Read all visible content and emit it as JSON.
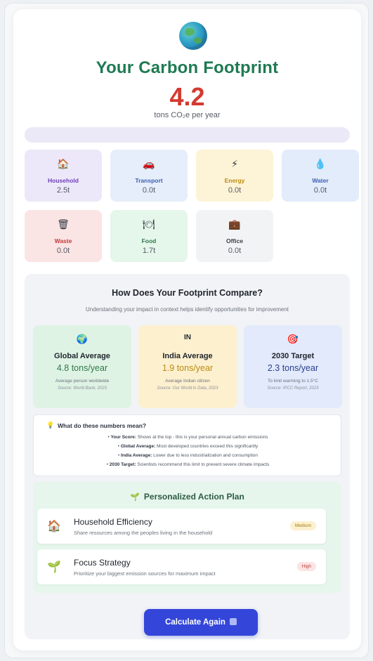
{
  "header": {
    "icon": "globe-icon",
    "title": "Your Carbon Footprint",
    "score": "4.2",
    "unit": "tons CO₂e per year"
  },
  "categories": [
    {
      "name": "Household",
      "value": "2.5t",
      "icon": "house-icon",
      "glyph": "🏠",
      "bg": "#ece8f9",
      "color": "#6d3fb8"
    },
    {
      "name": "Transport",
      "value": "0.0t",
      "icon": "car-icon",
      "glyph": "🚗",
      "bg": "#e6eefb",
      "color": "#3b5fb0"
    },
    {
      "name": "Energy",
      "value": "0.0t",
      "icon": "lightning-icon",
      "glyph": "⚡",
      "bg": "#fdf3d6",
      "color": "#b98b12"
    },
    {
      "name": "Water",
      "value": "0.0t",
      "icon": "droplet-icon",
      "glyph": "💧",
      "bg": "#e3ecfa",
      "color": "#3b5fb0"
    },
    {
      "name": "Waste",
      "value": "0.0t",
      "icon": "trash-icon",
      "glyph": "🗑",
      "bg": "#fbe4e4",
      "color": "#c23a3a"
    },
    {
      "name": "Food",
      "value": "1.7t",
      "icon": "plate-icon",
      "glyph": "🍽",
      "bg": "#e5f6ea",
      "color": "#2f7a4a"
    },
    {
      "name": "Office",
      "value": "0.0t",
      "icon": "briefcase-icon",
      "glyph": "💼",
      "bg": "#f2f3f5",
      "color": "#3a3f47"
    }
  ],
  "compare": {
    "title": "How Does Your Footprint Compare?",
    "subtitle": "Understanding your impact in context helps identify opportunities for improvement",
    "benchmarks": [
      {
        "icon_label": "🌍",
        "icon": "globe-icon",
        "name": "Global Average",
        "value": "4.8 tons/year",
        "desc": "Average person worldwide",
        "source": "Source: World Bank, 2023",
        "bg": "#dff3e5",
        "color": "#2f7a4a"
      },
      {
        "icon_label": "IN",
        "icon": "india-flag-icon",
        "name": "India Average",
        "value": "1.9 tons/year",
        "desc": "Average Indian citizen",
        "source": "Source: Our World in Data, 2023",
        "bg": "#fdf0cf",
        "color": "#b98b12"
      },
      {
        "icon_label": "🎯",
        "icon": "target-icon",
        "name": "2030 Target",
        "value": "2.3 tons/year",
        "desc": "To limit warming to 1.5°C",
        "source": "Source: IPCC Report, 2023",
        "bg": "#e2eafb",
        "color": "#2a3f8f"
      }
    ],
    "info": {
      "title": "What do these numbers mean?",
      "rows": [
        {
          "label": "Your Score:",
          "text": "Shows at the top - this is your personal annual carbon emissions"
        },
        {
          "label": "Global Average:",
          "text": "Most developed countries exceed this significantly"
        },
        {
          "label": "India Average:",
          "text": "Lower due to less industrialization and consumption"
        },
        {
          "label": "2030 Target:",
          "text": "Scientists recommend this limit to prevent severe climate impacts"
        }
      ]
    }
  },
  "plan": {
    "title": "Personalized Action Plan",
    "actions": [
      {
        "icon": "house-icon",
        "glyph": "🏠",
        "title": "Household Efficiency",
        "desc": "Share resources among the peoples living in the household",
        "priority": "Medium",
        "pill_bg": "#fdf0cf",
        "pill_color": "#a07a10"
      },
      {
        "icon": "sprout-icon",
        "glyph": "🌱",
        "title": "Focus Strategy",
        "desc": "Prioritize your biggest emission sources for maximum impact",
        "priority": "High",
        "pill_bg": "#fbe4e4",
        "pill_color": "#c23a3a"
      }
    ]
  },
  "footer": {
    "button_label": "Calculate Again"
  }
}
